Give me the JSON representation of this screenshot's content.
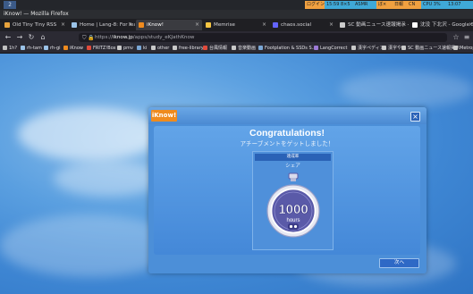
{
  "system_bar": {
    "workspace": "2",
    "tray": [
      "ログイン",
      "15:59 8×5",
      "ASMR",
      "ぼ×",
      "日報",
      "CN",
      "CPU 3%",
      "13:07"
    ]
  },
  "window_title": "iKnow! — Mozilla Firefox",
  "tabs": [
    {
      "label": "Old Tiny Tiny RSS",
      "fav_color": "#e8a33d",
      "active": false
    },
    {
      "label": "Home | Lang-8: For learn",
      "fav_color": "#9bc3e8",
      "active": false
    },
    {
      "label": "iKnow!",
      "fav_color": "#ef8b1e",
      "active": true
    },
    {
      "label": "Memrise",
      "fav_color": "#f5c542",
      "active": false
    },
    {
      "label": "chaos.social",
      "fav_color": "#6364ff",
      "active": false
    },
    {
      "label": "SC 動画ニュース速報掲示 - NetT",
      "fav_color": "#cccccc",
      "active": false
    },
    {
      "label": "沈没 下北沢 - Google Search",
      "fav_color": "#ffffff",
      "active": false
    }
  ],
  "nav": {
    "url_prefix": "https://",
    "url_domain": "iknow.jp",
    "url_path": "/apps/study_eKJathKnow"
  },
  "bookmarks": [
    {
      "label": "1h?",
      "color": "#c0c0c0"
    },
    {
      "label": "rh-tam",
      "color": "#9bc3e8"
    },
    {
      "label": "rh-gi",
      "color": "#9bc3e8"
    },
    {
      "label": "iKnow",
      "color": "#ef8b1e"
    },
    {
      "label": "FRITZ!Box",
      "color": "#e04a3b"
    },
    {
      "label": "pmv",
      "color": "#c9c9c9"
    },
    {
      "label": "ki",
      "color": "#7aa7d6"
    },
    {
      "label": "other",
      "color": "#c9c9c9"
    },
    {
      "label": "free-library",
      "color": "#c9c9c9"
    },
    {
      "label": "台風情報",
      "color": "#e04a3b"
    },
    {
      "label": "音楽動画",
      "color": "#c9c9c9"
    },
    {
      "label": "Footplation & SSDs S...",
      "color": "#7aa7d6"
    },
    {
      "label": "LangCorrect",
      "color": "#9c7ad6"
    },
    {
      "label": "漢字ペディア",
      "color": "#c9c9c9"
    },
    {
      "label": "漢字や",
      "color": "#c9c9c9"
    },
    {
      "label": "SC 動画ニュース速報掲示",
      "color": "#c9c9c9"
    },
    {
      "label": "Metropolis Magazin",
      "color": "#c9c9c9"
    }
  ],
  "dialog": {
    "logo": "iKnow!",
    "close_label": "×",
    "title": "Congratulations!",
    "subtitle": "アチーブメントをゲットしました！",
    "achievement_category": "達成率",
    "achievement_name": "シェア",
    "medal_number": "1000",
    "medal_unit": "hours",
    "next_button": "次へ"
  },
  "colors": {
    "logo_orange": "#ef8b1e",
    "medal_purple": "#5a5aa8",
    "button_blue": "#2e69c6"
  }
}
